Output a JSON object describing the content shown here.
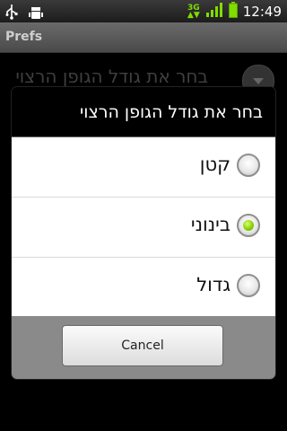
{
  "status_bar": {
    "time": "12:49",
    "network_type": "3G",
    "icons": [
      "usb-icon",
      "debug-icon",
      "network-3g-icon",
      "signal-icon",
      "battery-icon"
    ]
  },
  "app": {
    "title": "Prefs"
  },
  "background": {
    "pref_label": "בחר את גודל הגופן הרצוי"
  },
  "dialog": {
    "title": "בחר את גודל הגופן הרצוי",
    "options": [
      {
        "label": "קטן",
        "selected": false
      },
      {
        "label": "בינוני",
        "selected": true
      },
      {
        "label": "גדול",
        "selected": false
      }
    ],
    "cancel_label": "Cancel"
  },
  "colors": {
    "radio_selected": "#8bd100",
    "footer_bg": "#8a8a8a",
    "status_network": "#7fdd00"
  }
}
